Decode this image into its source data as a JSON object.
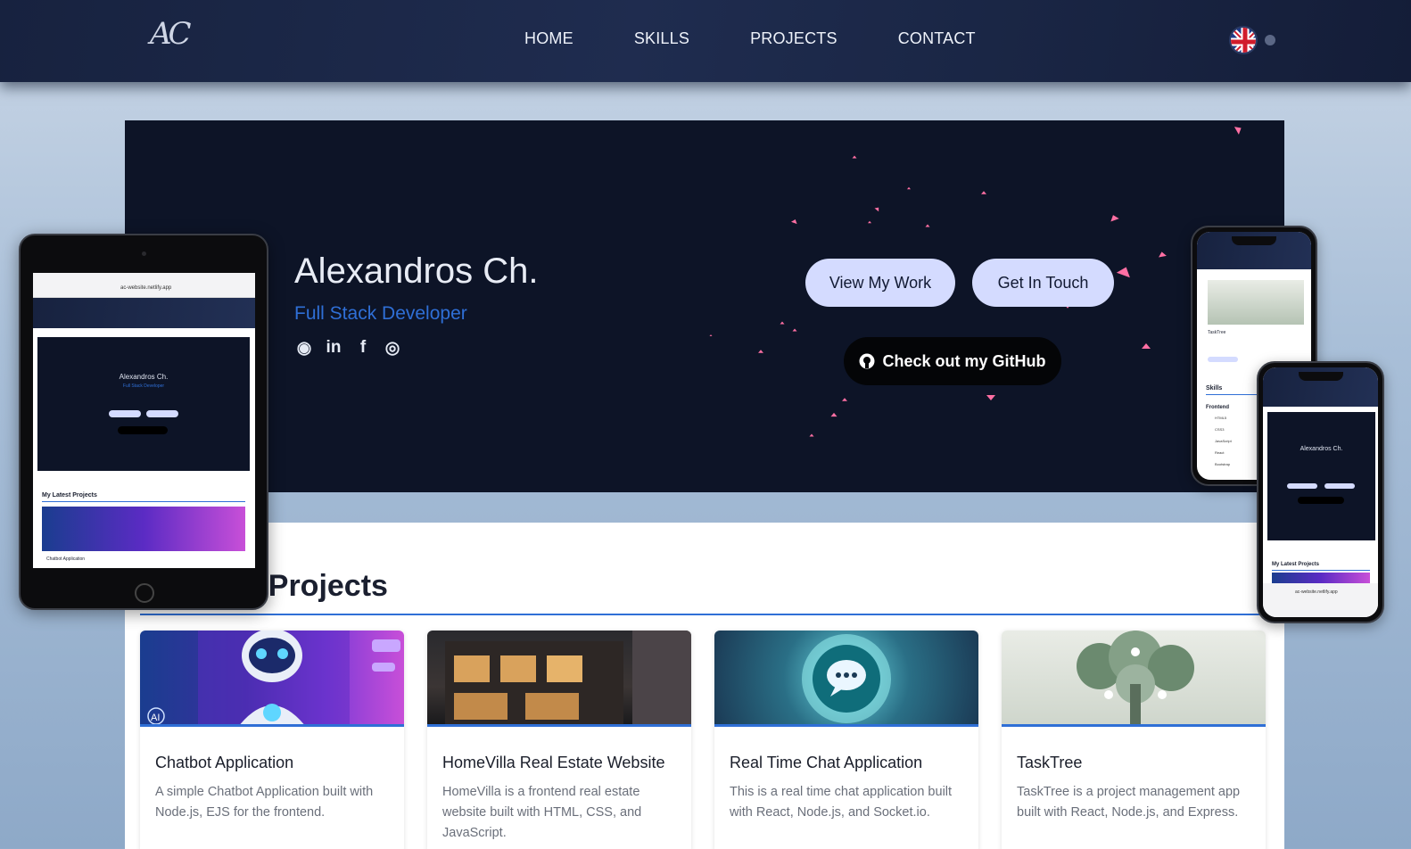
{
  "nav": {
    "logo": "AC",
    "links": [
      "HOME",
      "SKILLS",
      "PROJECTS",
      "CONTACT"
    ],
    "language_icon": "uk-flag-icon"
  },
  "hero": {
    "name": "Alexandros Ch.",
    "role": "Full Stack Developer",
    "socials": [
      {
        "icon": "github-icon",
        "glyph": "◉"
      },
      {
        "icon": "linkedin-icon",
        "glyph": "in"
      },
      {
        "icon": "facebook-icon",
        "glyph": "f"
      },
      {
        "icon": "instagram-icon",
        "glyph": "◎"
      }
    ],
    "view_work": "View My Work",
    "get_in_touch": "Get In Touch",
    "github": "Check out my GitHub"
  },
  "projects": {
    "title": "My Latest Projects",
    "visible_title": "t Projects",
    "cards": [
      {
        "title": "Chatbot Application",
        "desc": "A simple Chatbot Application built with Node.js, EJS for the frontend.",
        "image": "robot-image"
      },
      {
        "title": "HomeVilla Real Estate Website",
        "desc": "HomeVilla is a frontend real estate website built with HTML, CSS, and JavaScript.",
        "image": "house-image"
      },
      {
        "title": "Real Time Chat Application",
        "desc": "This is a real time chat application built with React, Node.js, and Socket.io.",
        "image": "chat-bubble-image"
      },
      {
        "title": "TaskTree",
        "desc": "TaskTree is a project management app built with React, Node.js, and Express.",
        "image": "tree-image"
      }
    ]
  },
  "devices": {
    "tablet": {
      "url": "ac-website.netlify.app",
      "name": "Alexandros Ch.",
      "role": "Full Stack Developer",
      "view_work": "View My Work",
      "get_in_touch": "Get In Touch",
      "github": "Check out my GitHub",
      "section": "My Latest Projects",
      "card": "Chatbot Application"
    },
    "phone1": {
      "card": "TaskTree",
      "section": "Skills",
      "subsection": "Frontend",
      "skills": [
        "HTML5",
        "CSS3",
        "JavaScript",
        "React",
        "Bootstrap"
      ]
    },
    "phone2": {
      "name": "Alexandros Ch.",
      "section": "My Latest Projects",
      "url": "ac-website.netlify.app"
    }
  },
  "colors": {
    "accent": "#2f6fd6",
    "hero_bg": "#0d1427",
    "pill": "#d4dbff",
    "particle": "#ff6fa3"
  }
}
